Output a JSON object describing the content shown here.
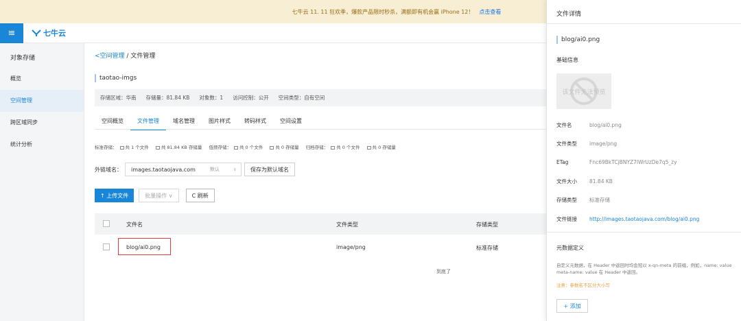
{
  "banner": {
    "text": "七牛云 11. 11 狂欢季，爆款产品限时秒杀，满额即有机会赢 iPhone 12！",
    "link": "点击查看"
  },
  "topbar": {
    "menu_icon": "≡",
    "logo_text": "七牛云"
  },
  "sidebar": {
    "title": "对象存储",
    "items": [
      {
        "label": "概览"
      },
      {
        "label": "空间管理",
        "active": true
      },
      {
        "label": "跨区域同步"
      },
      {
        "label": "统计分析"
      }
    ]
  },
  "breadcrumb": {
    "back": "<空间管理",
    "sep": " / ",
    "current": "文件管理"
  },
  "bucket": {
    "name": "taotao-imgs",
    "region": "存储区域：华南",
    "size": "存储量：81.84 KB",
    "objects": "对象数：1",
    "access": "访问控制：公开",
    "type": "空间类型：自有空间"
  },
  "tabs": [
    {
      "label": "空间概览"
    },
    {
      "label": "文件管理",
      "active": true
    },
    {
      "label": "域名管理"
    },
    {
      "label": "图片样式"
    },
    {
      "label": "转码样式"
    },
    {
      "label": "空间设置"
    }
  ],
  "stats": {
    "std_label": "标准存储：",
    "std_files": "共 1 个文件",
    "std_size": "共 81.84 KB 存储量",
    "low_label": "低频存储：",
    "low_files": "共 0 个文件",
    "low_size": "共 0 存储量",
    "arc_label": "归档存储：",
    "arc_files": "共 0 个文件",
    "arc_size": "共 0 存储量"
  },
  "domain": {
    "label": "外链域名：",
    "value": "images.taotaojava.com",
    "default_tag": "默认",
    "save_button": "保存为默认域名"
  },
  "toolbar": {
    "upload": "↑  上传文件",
    "batch": "批量操作  ∨",
    "refresh": "C  刷新"
  },
  "table": {
    "headers": {
      "name": "文件名",
      "type": "文件类型",
      "storage": "存储类型"
    },
    "rows": [
      {
        "name": "blog/ai0.png",
        "type": "image/png",
        "storage": "标准存储"
      }
    ],
    "end": "到底了"
  },
  "panel": {
    "title": "文件详情",
    "file": "blog/ai0.png",
    "basic_title": "基础信息",
    "preview_text": "该文件无法预览",
    "fields": [
      {
        "k": "文件名",
        "v": "blog/ai0.png"
      },
      {
        "k": "文件类型",
        "v": "image/png"
      },
      {
        "k": "ETag",
        "v": "Fnc69BkTCjBNYZ7IWrUzDe7q5_zy"
      },
      {
        "k": "文件大小",
        "v": "81.84 KB"
      },
      {
        "k": "存储类型",
        "v": "标准存储"
      },
      {
        "k": "文件链接",
        "v": "http://images.taotaojava.com/blog/ai0.png"
      }
    ],
    "meta_title": "元数据定义",
    "meta_desc": "自定义元数据，在 Header 中返回时均会冠以 x-qn-meta 的前缀，例如，name: value meta-name: value 在 Header 中返回。",
    "meta_warn": "注意：参数名不区分大小写",
    "add_button": "+ 添加"
  }
}
